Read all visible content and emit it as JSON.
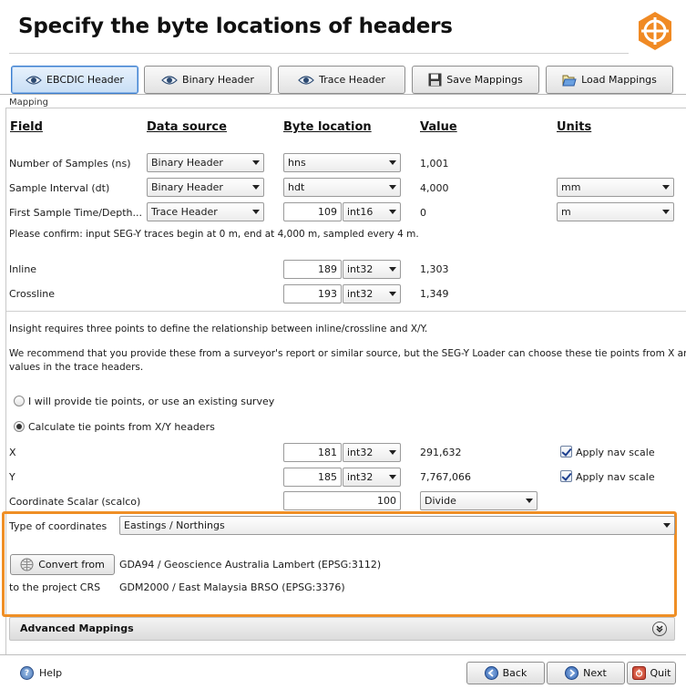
{
  "title": "Specify the byte locations of headers",
  "toolbar": {
    "ebcdic": "EBCDIC Header",
    "binary": "Binary Header",
    "trace": "Trace Header",
    "save": "Save Mappings",
    "load": "Load Mappings"
  },
  "panel_label": "Mapping",
  "columns": {
    "field": "Field",
    "source": "Data source",
    "byte": "Byte location",
    "value": "Value",
    "units": "Units"
  },
  "rows": {
    "ns": {
      "label": "Number of Samples (ns)",
      "source": "Binary Header",
      "byte": "hns",
      "value": "1,001"
    },
    "dt": {
      "label": "Sample Interval (dt)",
      "source": "Binary Header",
      "byte": "hdt",
      "value": "4,000",
      "unit": "mm"
    },
    "fst": {
      "label": "First Sample Time/Depth...",
      "source": "Trace Header",
      "byte": "109",
      "type": "int16",
      "value": "0",
      "unit": "m"
    },
    "confirm": "Please confirm: input SEG-Y traces begin at 0 m, end at 4,000 m, sampled every 4 m.",
    "inline": {
      "label": "Inline",
      "byte": "189",
      "type": "int32",
      "value": "1,303"
    },
    "crossline": {
      "label": "Crossline",
      "byte": "193",
      "type": "int32",
      "value": "1,349"
    }
  },
  "info": {
    "line1": "Insight requires three points to define the relationship between inline/crossline and X/Y.",
    "line2": "We recommend that you provide these from a surveyor's report or similar source, but the SEG-Y Loader can choose these tie points from X and Y",
    "line3": "values in the trace headers."
  },
  "options": {
    "provide": "I will provide tie points, or use an existing survey",
    "calculate": "Calculate tie points from X/Y headers"
  },
  "coords": {
    "x": {
      "label": "X",
      "byte": "181",
      "type": "int32",
      "value": "291,632",
      "apply": "Apply nav scale"
    },
    "y": {
      "label": "Y",
      "byte": "185",
      "type": "int32",
      "value": "7,767,066",
      "apply": "Apply nav scale"
    },
    "scalar": {
      "label": "Coordinate Scalar (scalco)",
      "value": "100",
      "mode": "Divide"
    }
  },
  "crs": {
    "type_label": "Type of coordinates",
    "type_value": "Eastings / Northings",
    "convert_button": "Convert from",
    "from": "GDA94 / Geoscience Australia Lambert (EPSG:3112)",
    "to_label": "to the project CRS",
    "to": "GDM2000 / East Malaysia BRSO (EPSG:3376)"
  },
  "advanced": "Advanced Mappings",
  "footer": {
    "help": "Help",
    "back": "Back",
    "next": "Next",
    "quit": "Quit"
  },
  "colors": {
    "highlight": "#ef8f26",
    "active_tab": "#3c7fd0",
    "logo": "#f08a24"
  }
}
